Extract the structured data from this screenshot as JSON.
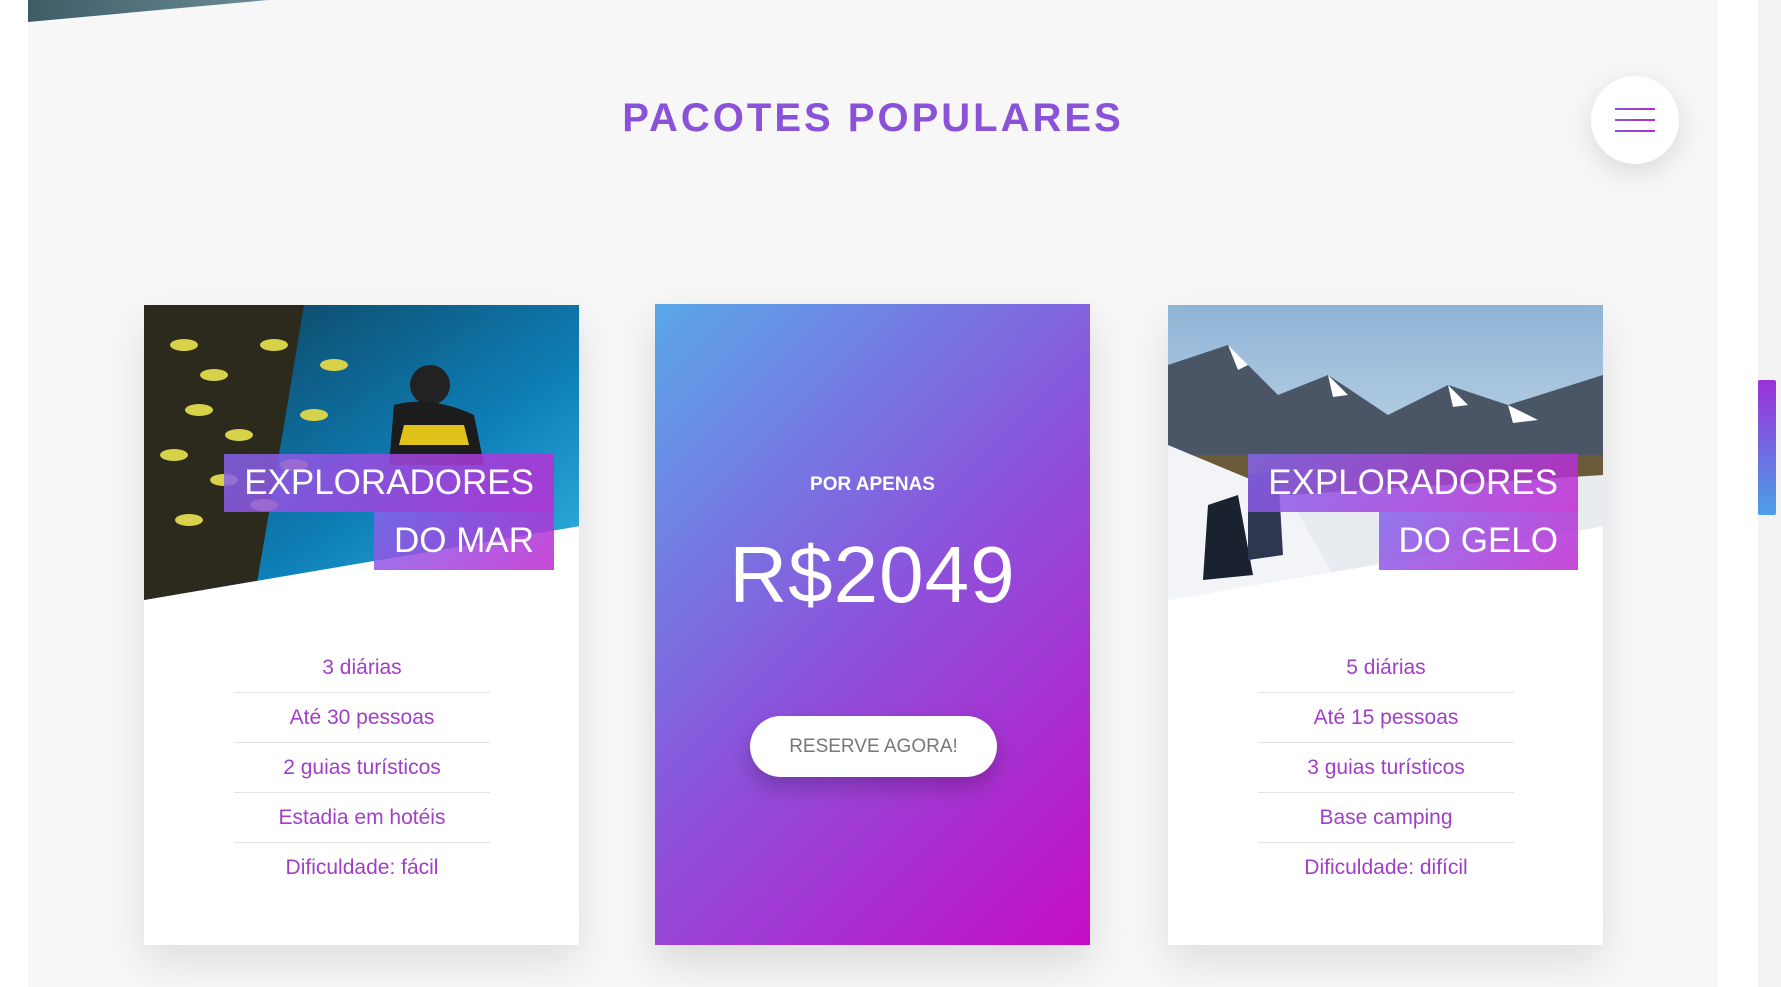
{
  "section": {
    "title": "PACOTES POPULARES"
  },
  "menu": {
    "icon": "hamburger-menu-icon"
  },
  "cards": {
    "sea": {
      "image": "diver-fish-reef-photo",
      "heading_1": "EXPLORADORES",
      "heading_2": "DO MAR",
      "features": [
        "3 diárias",
        "Até 30 pessoas",
        "2 guias turísticos",
        "Estadia em hotéis",
        "Dificuldade: fácil"
      ]
    },
    "ice": {
      "image": "snow-mountain-hikers-photo",
      "heading_1": "EXPLORADORES",
      "heading_2": "DO GELO",
      "features": [
        "5 diárias",
        "Até 15 pessoas",
        "3 guias turísticos",
        "Base camping",
        "Dificuldade: difícil"
      ]
    }
  },
  "price_card": {
    "label": "POR APENAS",
    "value": "R$2049",
    "button": "RESERVE AGORA!"
  },
  "colors": {
    "accent": "#8a52d8",
    "feature_text": "#a03ec8",
    "gradient_start": "#5aa8e9",
    "gradient_end": "#c50dc4"
  }
}
